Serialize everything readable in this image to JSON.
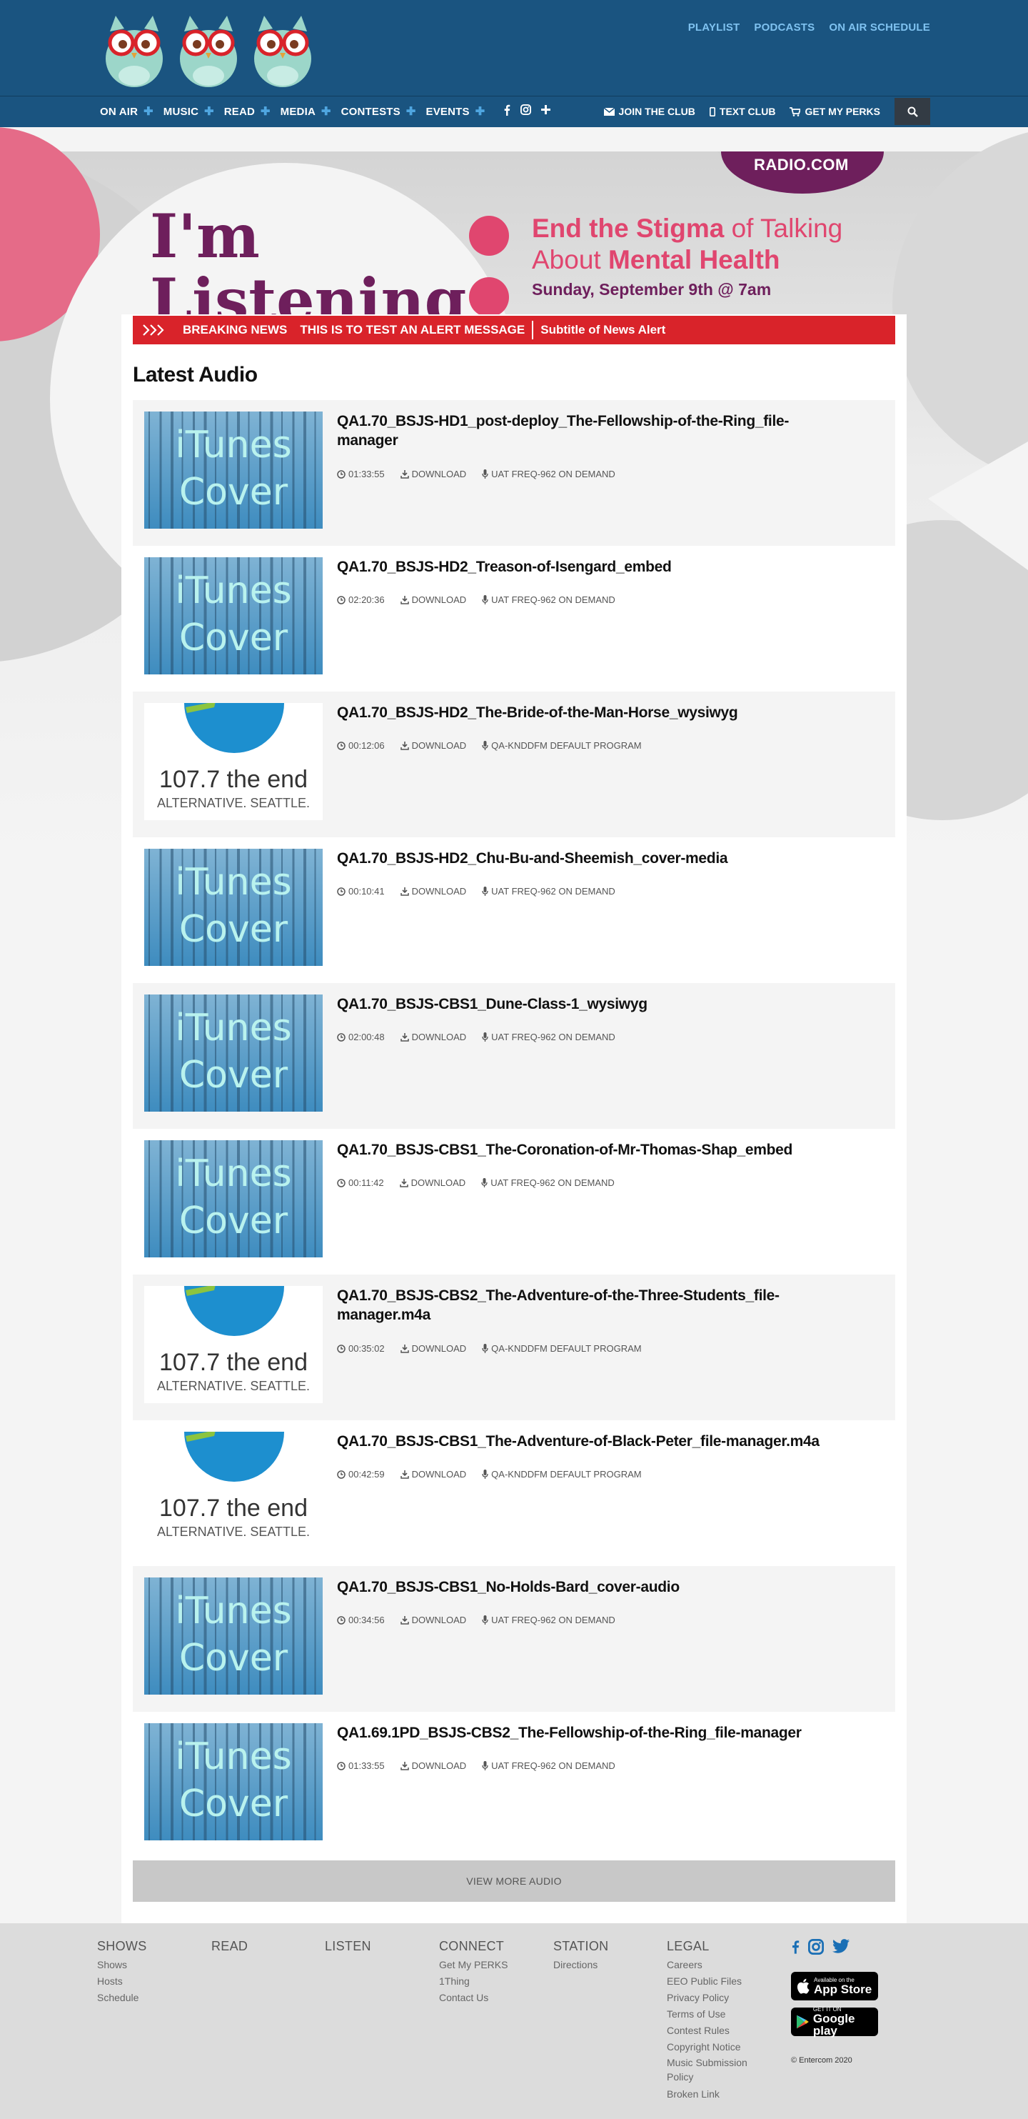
{
  "header": {
    "utility_links": [
      "PLAYLIST",
      "PODCASTS",
      "ON AIR SCHEDULE"
    ],
    "nav_items": [
      "ON AIR",
      "MUSIC",
      "READ",
      "MEDIA",
      "CONTESTS",
      "EVENTS"
    ],
    "right_nav": {
      "join": "JOIN THE CLUB",
      "text": "TEXT CLUB",
      "perks": "GET MY PERKS"
    }
  },
  "hero": {
    "brand": "RADIO.COM",
    "headline": "I'm Listening",
    "tagline_line1_emph": "End the Stigma",
    "tagline_line1_rest": " of Talking",
    "tagline_line2_pre": "About ",
    "tagline_line2_emph": "Mental Health",
    "date": "Sunday, September 9th @ 7am"
  },
  "alert": {
    "label": "BREAKING NEWS",
    "message": "THIS IS TO TEST AN ALERT MESSAGE",
    "subtitle": "Subtitle of News Alert"
  },
  "latest_audio": {
    "heading": "Latest Audio",
    "download_label": "DOWNLOAD",
    "items": [
      {
        "title": "QA1.70_BSJS-HD1_post-deploy_The-Fellowship-of-the-Ring_file-manager",
        "duration": "01:33:55",
        "program": "UAT FREQ-962 ON DEMAND",
        "thumb": "itunes"
      },
      {
        "title": "QA1.70_BSJS-HD2_Treason-of-Isengard_embed",
        "duration": "02:20:36",
        "program": "UAT FREQ-962 ON DEMAND",
        "thumb": "itunes"
      },
      {
        "title": "QA1.70_BSJS-HD2_The-Bride-of-the-Man-Horse_wysiwyg",
        "duration": "00:12:06",
        "program": "QA-KNDDFM DEFAULT PROGRAM",
        "thumb": "end"
      },
      {
        "title": "QA1.70_BSJS-HD2_Chu-Bu-and-Sheemish_cover-media",
        "duration": "00:10:41",
        "program": "UAT FREQ-962 ON DEMAND",
        "thumb": "itunes"
      },
      {
        "title": "QA1.70_BSJS-CBS1_Dune-Class-1_wysiwyg",
        "duration": "02:00:48",
        "program": "UAT FREQ-962 ON DEMAND",
        "thumb": "itunes"
      },
      {
        "title": "QA1.70_BSJS-CBS1_The-Coronation-of-Mr-Thomas-Shap_embed",
        "duration": "00:11:42",
        "program": "UAT FREQ-962 ON DEMAND",
        "thumb": "itunes"
      },
      {
        "title": "QA1.70_BSJS-CBS2_The-Adventure-of-the-Three-Students_file-manager.m4a",
        "duration": "00:35:02",
        "program": "QA-KNDDFM DEFAULT PROGRAM",
        "thumb": "end"
      },
      {
        "title": "QA1.70_BSJS-CBS1_The-Adventure-of-Black-Peter_file-manager.m4a",
        "duration": "00:42:59",
        "program": "QA-KNDDFM DEFAULT PROGRAM",
        "thumb": "end"
      },
      {
        "title": "QA1.70_BSJS-CBS1_No-Holds-Bard_cover-audio",
        "duration": "00:34:56",
        "program": "UAT FREQ-962 ON DEMAND",
        "thumb": "itunes"
      },
      {
        "title": "QA1.69.1PD_BSJS-CBS2_The-Fellowship-of-the-Ring_file-manager",
        "duration": "01:33:55",
        "program": "UAT FREQ-962 ON DEMAND",
        "thumb": "itunes"
      }
    ],
    "thumb_text": {
      "itunes_line1": "iTunes",
      "itunes_line2": "Cover",
      "end_freq": "107.7 the end",
      "end_sub": "ALTERNATIVE. SEATTLE."
    },
    "view_more": "VIEW MORE AUDIO"
  },
  "footer": {
    "columns": [
      {
        "heading": "SHOWS",
        "links": [
          "Shows",
          "Hosts",
          "Schedule"
        ]
      },
      {
        "heading": "READ",
        "links": []
      },
      {
        "heading": "LISTEN",
        "links": []
      },
      {
        "heading": "CONNECT",
        "links": [
          "Get My PERKS",
          "1Thing",
          "Contact Us"
        ]
      },
      {
        "heading": "STATION",
        "links": [
          "Directions"
        ]
      },
      {
        "heading": "LEGAL",
        "links": [
          "Careers",
          "EEO Public Files",
          "Privacy Policy",
          "Terms of Use",
          "Contest Rules",
          "Copyright Notice",
          "Music Submission Policy",
          "Broken Link"
        ]
      }
    ],
    "app_store": {
      "small": "Available on the",
      "big": "App Store"
    },
    "google_play": {
      "small": "GET IT ON",
      "big": "Google play"
    },
    "copyright": "© Entercom 2020"
  },
  "colors": {
    "header_bg": "#1a5480",
    "nav_plus": "#4fa6e0",
    "utility_link": "#7fc2f0",
    "alert_bg": "#d9232a",
    "hero_purple": "#6e1f5c",
    "hero_pink": "#e0466f",
    "social_blue": "#1a6fb5"
  },
  "icons": [
    "owl-logo",
    "facebook-icon",
    "instagram-icon",
    "plus-icon",
    "envelope-icon",
    "phone-icon",
    "cart-icon",
    "search-icon",
    "chevrons-icon",
    "clock-icon",
    "download-icon",
    "microphone-icon",
    "twitter-icon",
    "apple-icon",
    "google-play-icon"
  ]
}
